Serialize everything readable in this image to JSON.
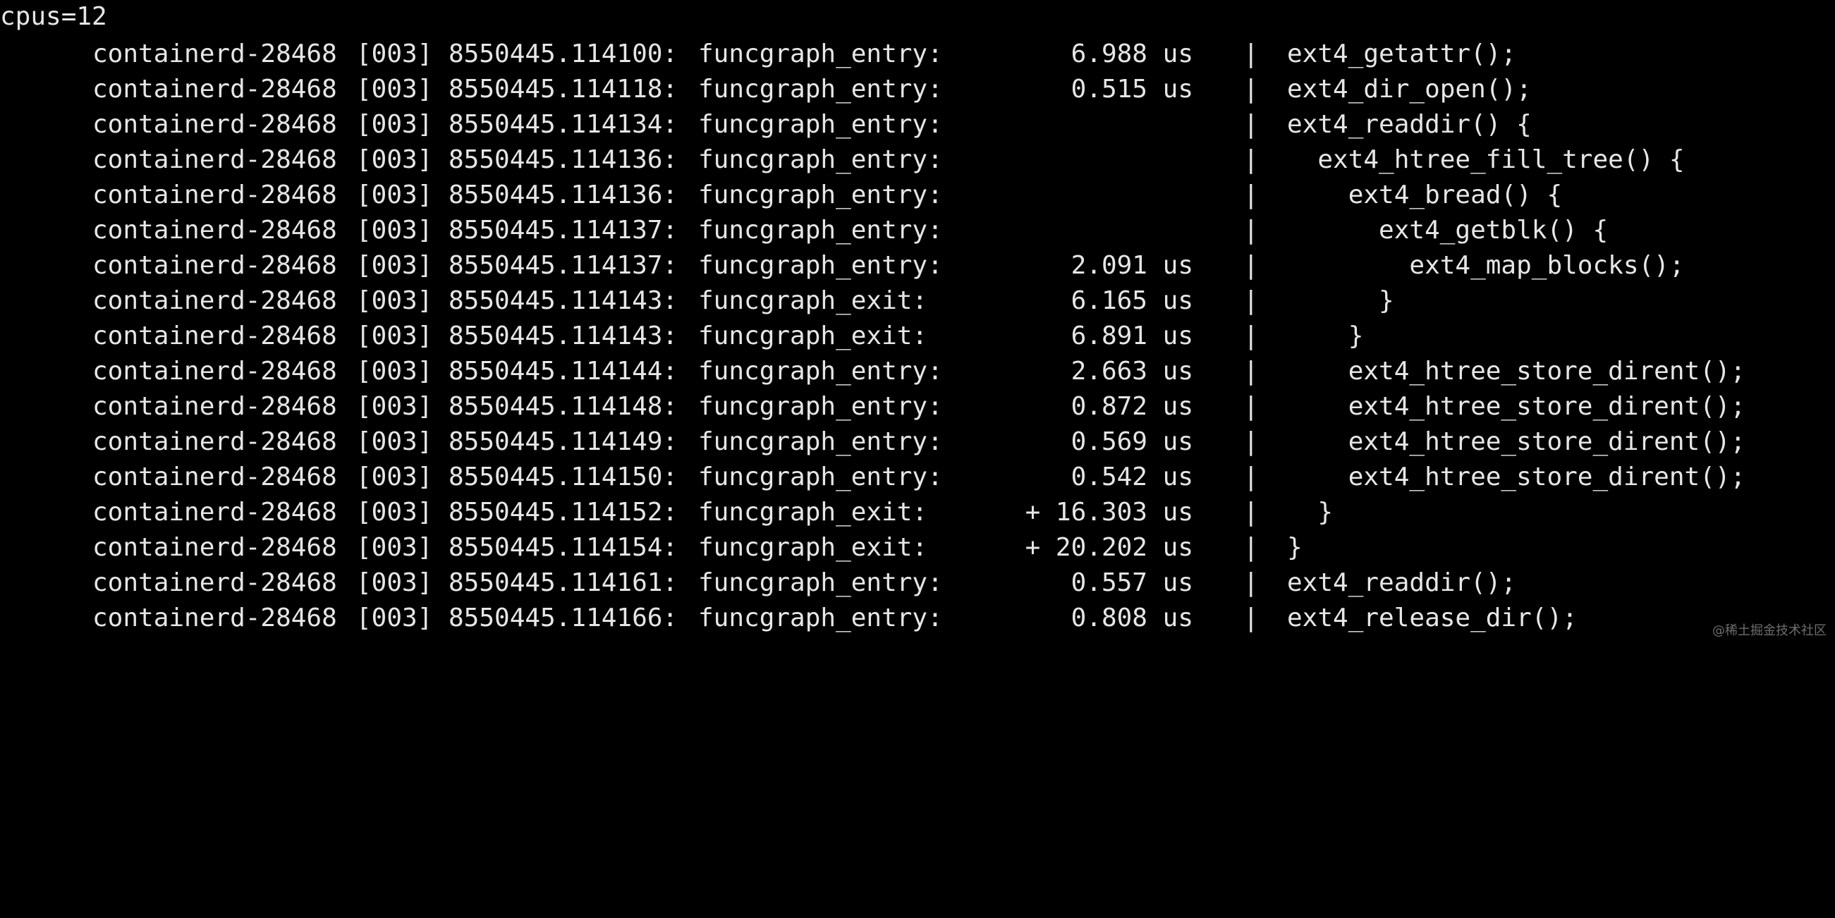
{
  "terminal": {
    "header": "cpus=12",
    "watermark": "@稀土掘金技术社区",
    "rows": [
      {
        "task": "containerd-28468",
        "cpu": "[003]",
        "timestamp": "8550445.114100:",
        "event": "funcgraph_entry:",
        "duration": "6.988 us",
        "sep": "|",
        "func": "ext4_getattr();"
      },
      {
        "task": "containerd-28468",
        "cpu": "[003]",
        "timestamp": "8550445.114118:",
        "event": "funcgraph_entry:",
        "duration": "0.515 us",
        "sep": "|",
        "func": "ext4_dir_open();"
      },
      {
        "task": "containerd-28468",
        "cpu": "[003]",
        "timestamp": "8550445.114134:",
        "event": "funcgraph_entry:",
        "duration": "",
        "sep": "|",
        "func": "ext4_readdir() {"
      },
      {
        "task": "containerd-28468",
        "cpu": "[003]",
        "timestamp": "8550445.114136:",
        "event": "funcgraph_entry:",
        "duration": "",
        "sep": "|",
        "func": "  ext4_htree_fill_tree() {"
      },
      {
        "task": "containerd-28468",
        "cpu": "[003]",
        "timestamp": "8550445.114136:",
        "event": "funcgraph_entry:",
        "duration": "",
        "sep": "|",
        "func": "    ext4_bread() {"
      },
      {
        "task": "containerd-28468",
        "cpu": "[003]",
        "timestamp": "8550445.114137:",
        "event": "funcgraph_entry:",
        "duration": "",
        "sep": "|",
        "func": "      ext4_getblk() {"
      },
      {
        "task": "containerd-28468",
        "cpu": "[003]",
        "timestamp": "8550445.114137:",
        "event": "funcgraph_entry:",
        "duration": "2.091 us",
        "sep": "|",
        "func": "        ext4_map_blocks();"
      },
      {
        "task": "containerd-28468",
        "cpu": "[003]",
        "timestamp": "8550445.114143:",
        "event": "funcgraph_exit:",
        "duration": "6.165 us",
        "sep": "|",
        "func": "      }"
      },
      {
        "task": "containerd-28468",
        "cpu": "[003]",
        "timestamp": "8550445.114143:",
        "event": "funcgraph_exit:",
        "duration": "6.891 us",
        "sep": "|",
        "func": "    }"
      },
      {
        "task": "containerd-28468",
        "cpu": "[003]",
        "timestamp": "8550445.114144:",
        "event": "funcgraph_entry:",
        "duration": "2.663 us",
        "sep": "|",
        "func": "    ext4_htree_store_dirent();"
      },
      {
        "task": "containerd-28468",
        "cpu": "[003]",
        "timestamp": "8550445.114148:",
        "event": "funcgraph_entry:",
        "duration": "0.872 us",
        "sep": "|",
        "func": "    ext4_htree_store_dirent();"
      },
      {
        "task": "containerd-28468",
        "cpu": "[003]",
        "timestamp": "8550445.114149:",
        "event": "funcgraph_entry:",
        "duration": "0.569 us",
        "sep": "|",
        "func": "    ext4_htree_store_dirent();"
      },
      {
        "task": "containerd-28468",
        "cpu": "[003]",
        "timestamp": "8550445.114150:",
        "event": "funcgraph_entry:",
        "duration": "0.542 us",
        "sep": "|",
        "func": "    ext4_htree_store_dirent();"
      },
      {
        "task": "containerd-28468",
        "cpu": "[003]",
        "timestamp": "8550445.114152:",
        "event": "funcgraph_exit:",
        "duration": "+ 16.303 us",
        "sep": "|",
        "func": "  }"
      },
      {
        "task": "containerd-28468",
        "cpu": "[003]",
        "timestamp": "8550445.114154:",
        "event": "funcgraph_exit:",
        "duration": "+ 20.202 us",
        "sep": "|",
        "func": "}"
      },
      {
        "task": "containerd-28468",
        "cpu": "[003]",
        "timestamp": "8550445.114161:",
        "event": "funcgraph_entry:",
        "duration": "0.557 us",
        "sep": "|",
        "func": "ext4_readdir();"
      },
      {
        "task": "containerd-28468",
        "cpu": "[003]",
        "timestamp": "8550445.114166:",
        "event": "funcgraph_entry:",
        "duration": "0.808 us",
        "sep": "|",
        "func": "ext4_release_dir();"
      }
    ]
  }
}
